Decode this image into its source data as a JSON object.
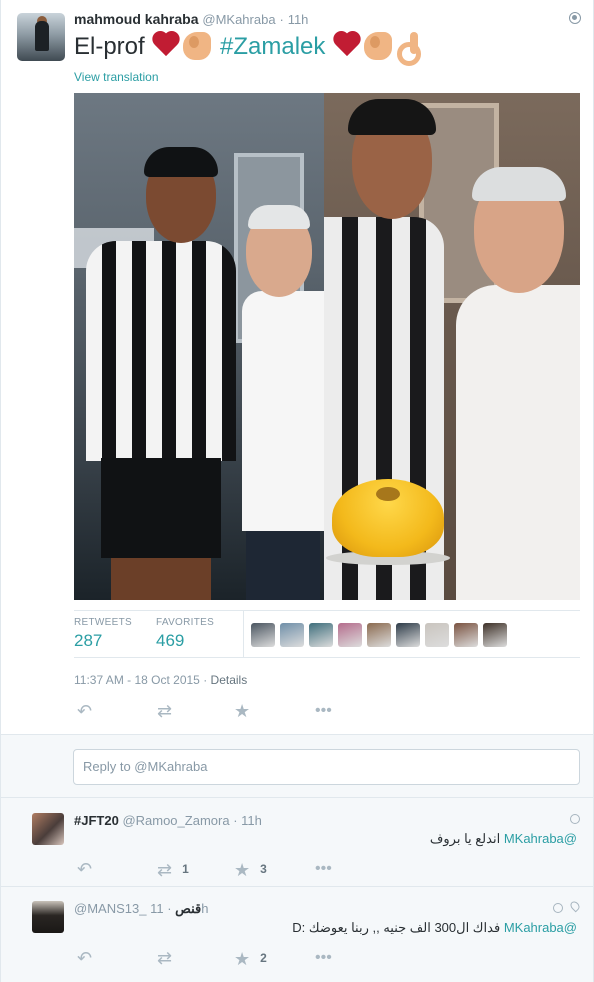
{
  "tweet": {
    "author_name": "mahmoud kahraba",
    "author_handle": "@MKahraba",
    "separator": "·",
    "age": "11h",
    "text_prefix": "El-prof",
    "hashtag": "#Zamalek",
    "emoji_names": [
      "heart-icon",
      "flexed-biceps-icon",
      "ok-hand-icon"
    ],
    "view_translation": "View translation",
    "retweets_label": "RETWEETS",
    "retweets": "287",
    "favorites_label": "FAVORITES",
    "favorites": "469",
    "timestamp": "11:37 AM - 18 Oct 2015",
    "details_label": "Details",
    "accent_color": "#2b9ea4",
    "heart_color": "#c11c33"
  },
  "reply_input": {
    "placeholder": "Reply to @MKahraba"
  },
  "replies": [
    {
      "name": "#JFT20",
      "handle": "@Ramoo_Zamora",
      "age": "11h",
      "mention": "@MKahraba",
      "text": "اندلع يا بروف",
      "retweets": "1",
      "favorites": "3"
    },
    {
      "name": "قنص",
      "handle": "@MANS13_",
      "age": "11h",
      "mention": "@MKahraba",
      "text": "فداك ال300 الف جنيه ,, ربنا يعوضك :D",
      "retweets": "",
      "favorites": "2"
    }
  ],
  "favoriter_avatar_colors": [
    "#4a5560",
    "#6f8fa8",
    "#3e6e7c",
    "#b46c8c",
    "#8b6a4f",
    "#2d3b48",
    "#c9c4be",
    "#7a5240",
    "#3d3027"
  ],
  "bg_colors": {
    "page": "#ffffff",
    "reply_area": "#f5f8fa",
    "meta_text": "#8899a6"
  }
}
